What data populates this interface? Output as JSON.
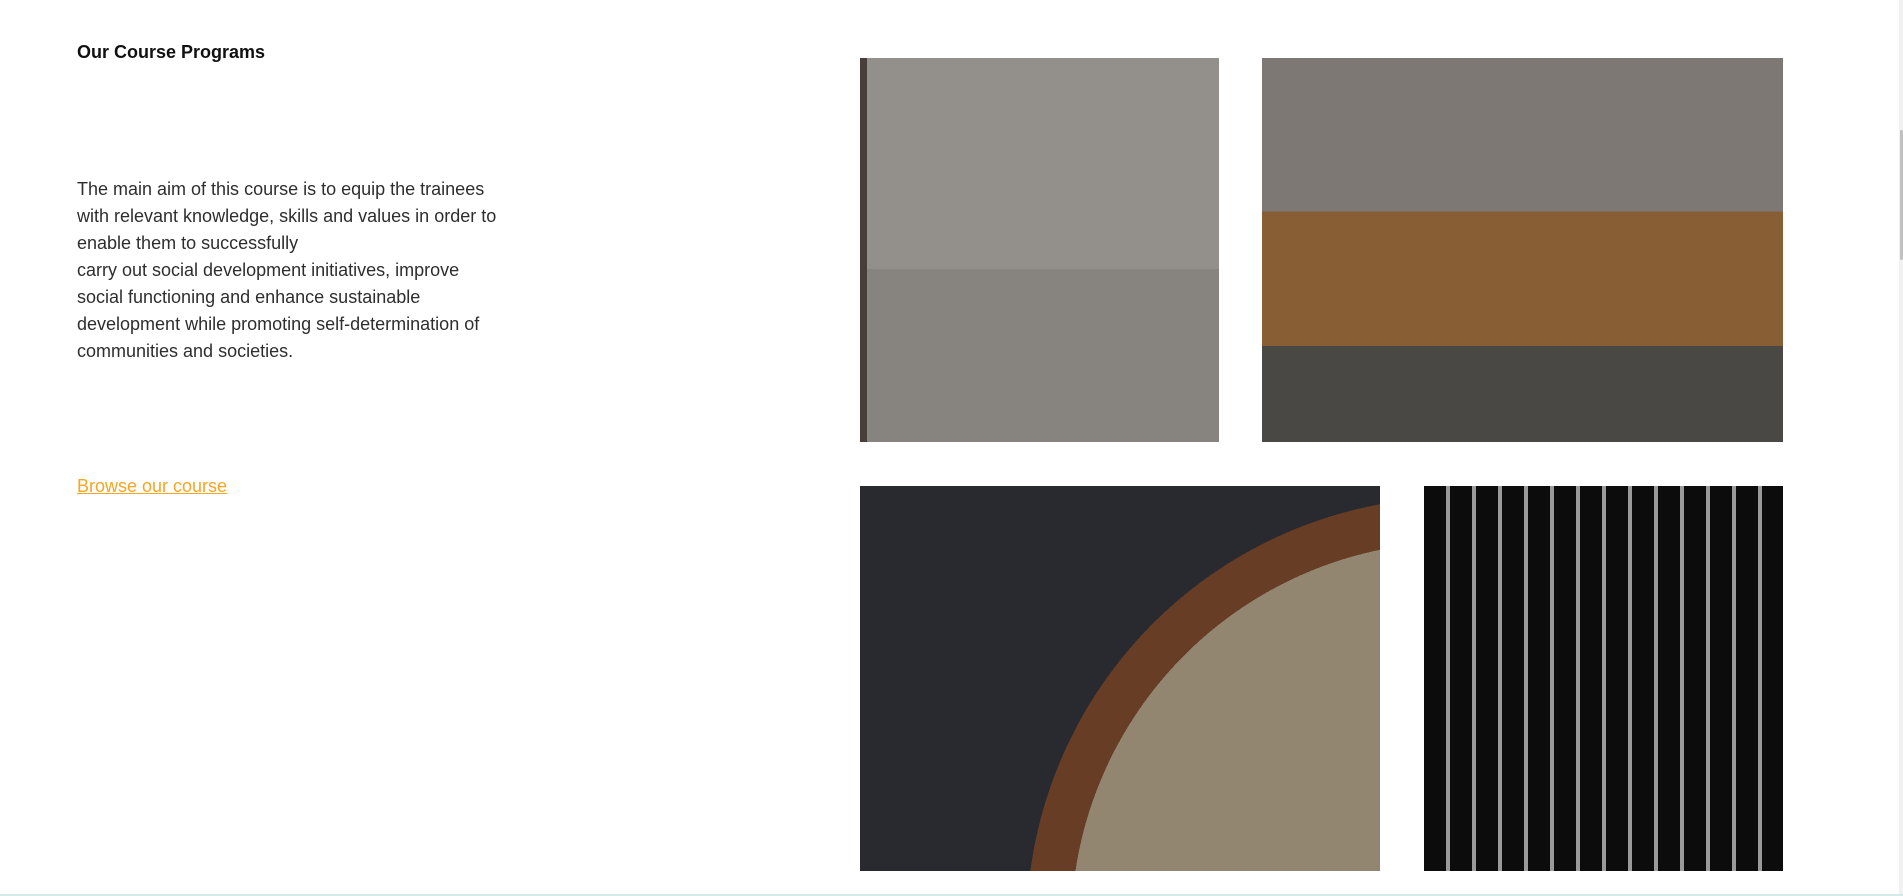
{
  "section": {
    "title": "Our Course Programs",
    "description_lines": [
      "The main aim of this course is to equip the trainees",
      "with relevant knowledge, skills and values in order to",
      "enable them to successfully",
      "carry out social development initiatives, improve",
      "social functioning and enhance sustainable",
      "development while promoting self-determination of",
      "communities and societies."
    ],
    "browse_link": "Browse our course"
  },
  "colors": {
    "link": "#f5a623",
    "heading": "#111111",
    "body_text": "#2e2e2e"
  }
}
